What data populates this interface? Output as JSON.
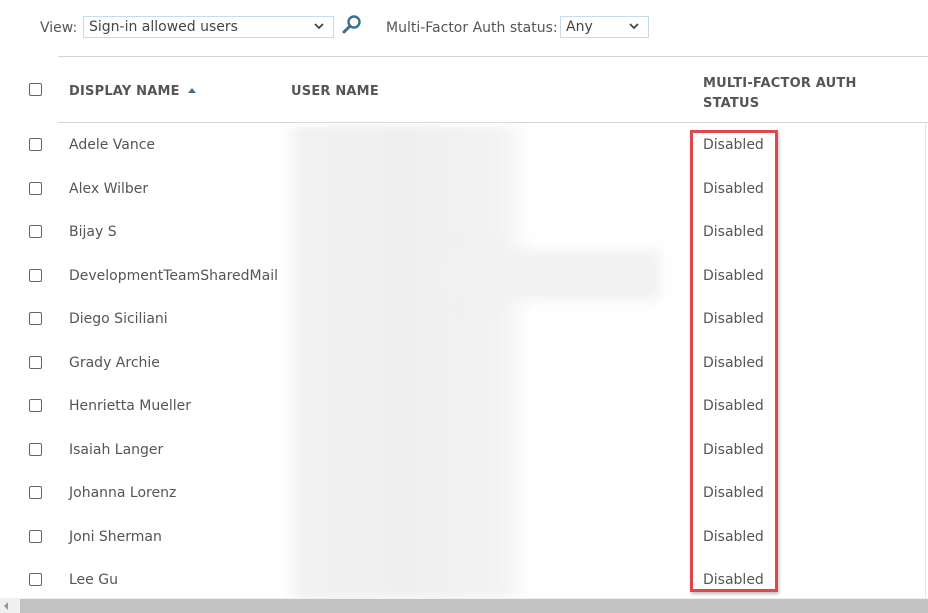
{
  "toolbar": {
    "view_label": "View:",
    "view_value": "Sign-in allowed users",
    "mfa_label": "Multi-Factor Auth status:",
    "mfa_value": "Any"
  },
  "table": {
    "columns": {
      "display_name": "DISPLAY NAME",
      "user_name": "USER NAME",
      "mfa_status_line1": "MULTI-FACTOR AUTH",
      "mfa_status_line2": "STATUS"
    },
    "sort": {
      "column": "display_name",
      "direction": "ascending"
    },
    "rows": [
      {
        "display_name": "Adele Vance",
        "mfa_status": "Disabled"
      },
      {
        "display_name": "Alex Wilber",
        "mfa_status": "Disabled"
      },
      {
        "display_name": "Bijay S",
        "mfa_status": "Disabled"
      },
      {
        "display_name": "DevelopmentTeamSharedMail",
        "mfa_status": "Disabled"
      },
      {
        "display_name": "Diego Siciliani",
        "mfa_status": "Disabled"
      },
      {
        "display_name": "Grady Archie",
        "mfa_status": "Disabled"
      },
      {
        "display_name": "Henrietta Mueller",
        "mfa_status": "Disabled"
      },
      {
        "display_name": "Isaiah Langer",
        "mfa_status": "Disabled"
      },
      {
        "display_name": "Johanna Lorenz",
        "mfa_status": "Disabled"
      },
      {
        "display_name": "Joni Sherman",
        "mfa_status": "Disabled"
      },
      {
        "display_name": "Lee Gu",
        "mfa_status": "Disabled"
      }
    ]
  },
  "annotation": {
    "highlight_color": "#e0474c"
  }
}
